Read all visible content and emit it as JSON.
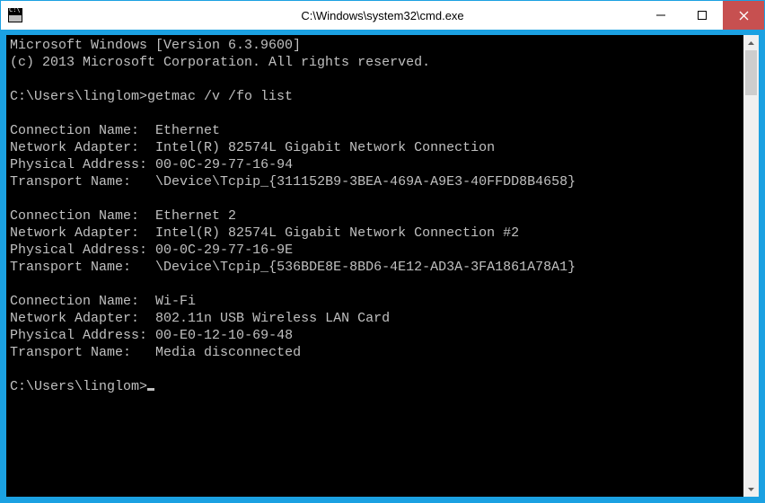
{
  "window": {
    "title": "C:\\Windows\\system32\\cmd.exe"
  },
  "console": {
    "header_line1": "Microsoft Windows [Version 6.3.9600]",
    "header_line2": "(c) 2013 Microsoft Corporation. All rights reserved.",
    "prompt1": "C:\\Users\\linglom>",
    "command1": "getmac /v /fo list",
    "connections": [
      {
        "name_label": "Connection Name:",
        "name_value": "Ethernet",
        "adapter_label": "Network Adapter:",
        "adapter_value": "Intel(R) 82574L Gigabit Network Connection",
        "physaddr_label": "Physical Address:",
        "physaddr_value": "00-0C-29-77-16-94",
        "transport_label": "Transport Name:",
        "transport_value": "\\Device\\Tcpip_{311152B9-3BEA-469A-A9E3-40FFDD8B4658}"
      },
      {
        "name_label": "Connection Name:",
        "name_value": "Ethernet 2",
        "adapter_label": "Network Adapter:",
        "adapter_value": "Intel(R) 82574L Gigabit Network Connection #2",
        "physaddr_label": "Physical Address:",
        "physaddr_value": "00-0C-29-77-16-9E",
        "transport_label": "Transport Name:",
        "transport_value": "\\Device\\Tcpip_{536BDE8E-8BD6-4E12-AD3A-3FA1861A78A1}"
      },
      {
        "name_label": "Connection Name:",
        "name_value": "Wi-Fi",
        "adapter_label": "Network Adapter:",
        "adapter_value": "802.11n USB Wireless LAN Card",
        "physaddr_label": "Physical Address:",
        "physaddr_value": "00-E0-12-10-69-48",
        "transport_label": "Transport Name:",
        "transport_value": "Media disconnected"
      }
    ],
    "prompt2": "C:\\Users\\linglom>"
  }
}
